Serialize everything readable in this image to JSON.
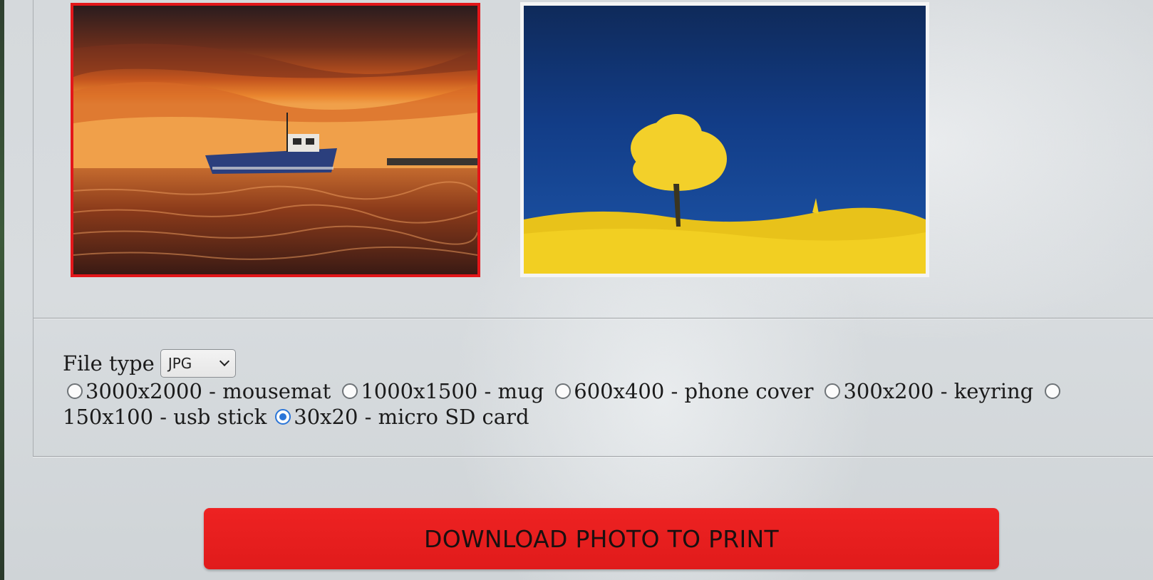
{
  "gallery": {
    "photos": [
      {
        "name": "sunset-boat-photo",
        "selected": true
      },
      {
        "name": "yellow-tree-photo",
        "selected": false
      }
    ]
  },
  "options": {
    "file_type_label": "File type",
    "file_type_value": "JPG",
    "sizes": [
      {
        "label": "3000x2000 - mousemat",
        "checked": false
      },
      {
        "label": "1000x1500 - mug",
        "checked": false
      },
      {
        "label": "600x400 - phone cover",
        "checked": false
      },
      {
        "label": "300x200 - keyring",
        "checked": false
      },
      {
        "label": "150x100 - usb stick",
        "checked": false
      },
      {
        "label": "30x20 - micro SD card",
        "checked": true
      }
    ]
  },
  "download_button": {
    "label": "DOWNLOAD PHOTO TO PRINT"
  },
  "colors": {
    "accent": "#e3161a",
    "radio_checked": "#2a75d8"
  }
}
